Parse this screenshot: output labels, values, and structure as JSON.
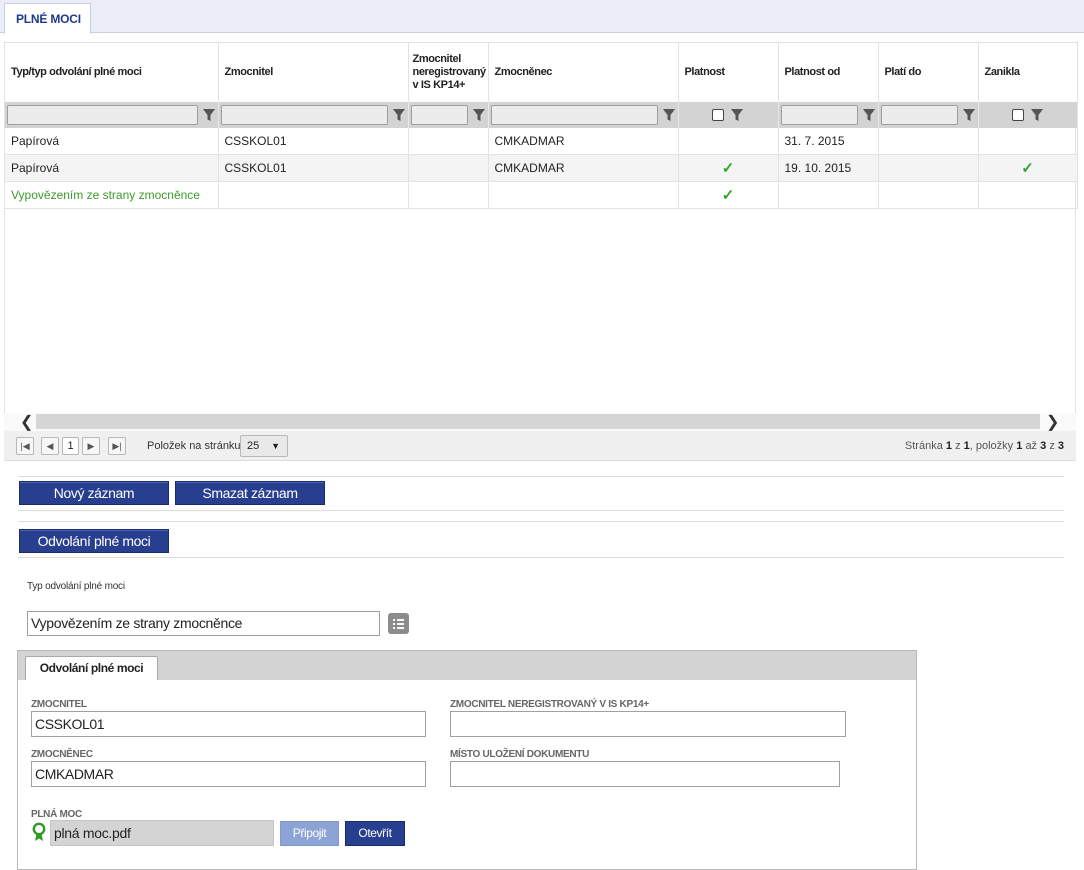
{
  "tab": {
    "label": "PLNÉ MOCI"
  },
  "grid": {
    "columns": [
      "Typ/typ odvolání plné moci",
      "Zmocnitel",
      "Zmocnitel neregistrovaný v IS KP14+",
      "Zmocněnec",
      "Platnost",
      "Platnost od",
      "Platí do",
      "Zanikla"
    ],
    "rows": [
      {
        "typ": "Papírová",
        "zmocnitel": "CSSKOL01",
        "nereg": "",
        "zmocnenec": "CMKADMAR",
        "platnost": false,
        "platnost_od": "31. 7. 2015",
        "plati_do": "",
        "zanikla": false
      },
      {
        "typ": "Papírová",
        "zmocnitel": "CSSKOL01",
        "nereg": "",
        "zmocnenec": "CMKADMAR",
        "platnost": true,
        "platnost_od": "19. 10. 2015",
        "plati_do": "",
        "zanikla": true
      },
      {
        "typ": "Vypovězením ze strany zmocněnce",
        "zmocnitel": "",
        "nereg": "",
        "zmocnenec": "",
        "platnost": true,
        "platnost_od": "",
        "plati_do": "",
        "zanikla": false
      }
    ],
    "check_glyph": "✓"
  },
  "pager": {
    "current_page": "1",
    "per_page_label": "Položek na stránku",
    "per_page_value": "25",
    "info_prefix": "Stránka",
    "info_page": "1",
    "info_of": "z",
    "info_pages": "1",
    "info_items": ", položky",
    "info_from": "1",
    "info_to_word": "až",
    "info_to": "3",
    "info_of2": "z",
    "info_total": "3"
  },
  "actions": {
    "new_record": "Nový záznam",
    "delete_record": "Smazat záznam",
    "revoke": "Odvolání plné moci"
  },
  "revoke_type": {
    "label": "Typ odvolání plné moci",
    "value": "Vypovězením ze strany zmocněnce"
  },
  "detail": {
    "tab_label": "Odvolání plné moci",
    "zmocnitel_label": "ZMOCNITEL",
    "zmocnitel_value": "CSSKOL01",
    "nereg_label": "ZMOCNITEL NEREGISTROVANÝ V IS KP14+",
    "nereg_value": "",
    "zmocnenec_label": "ZMOCNĚNEC",
    "zmocnenec_value": "CMKADMAR",
    "misto_label": "MÍSTO ULOŽENÍ DOKUMENTU",
    "misto_value": "",
    "plna_moc_label": "PLNÁ MOC",
    "file_name": "plná moc.pdf",
    "attach_button": "Připojit",
    "open_button": "Otevřít"
  },
  "colors": {
    "accent_blue": "#283f8f",
    "green_text": "#3c9b2a",
    "check_green": "#36a32e",
    "attach_disabled": "#8da3d6"
  }
}
